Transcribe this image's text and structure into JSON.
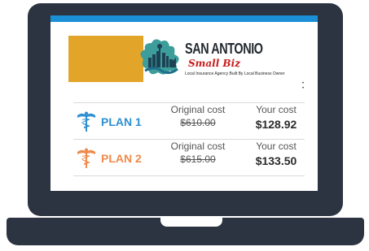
{
  "brand": {
    "title": "SAN ANTONIO",
    "script": "Small Biz",
    "tagline": "Local Insurance Agency Built By Local Business Owner",
    "marks": "• •"
  },
  "plans": [
    {
      "name": "PLAN 1",
      "original_label": "Original cost",
      "original_price": "$610.00",
      "your_label": "Your cost",
      "your_price": "$128.92",
      "color": "#2f8fd0"
    },
    {
      "name": "PLAN 2",
      "original_label": "Original cost",
      "original_price": "$615.00",
      "your_label": "Your cost",
      "your_price": "$133.50",
      "color": "#ef8a4a"
    }
  ],
  "colors": {
    "laptop": "#2b3440",
    "screen_bar": "#1b90d6",
    "banner_gold": "#e2a52a"
  }
}
